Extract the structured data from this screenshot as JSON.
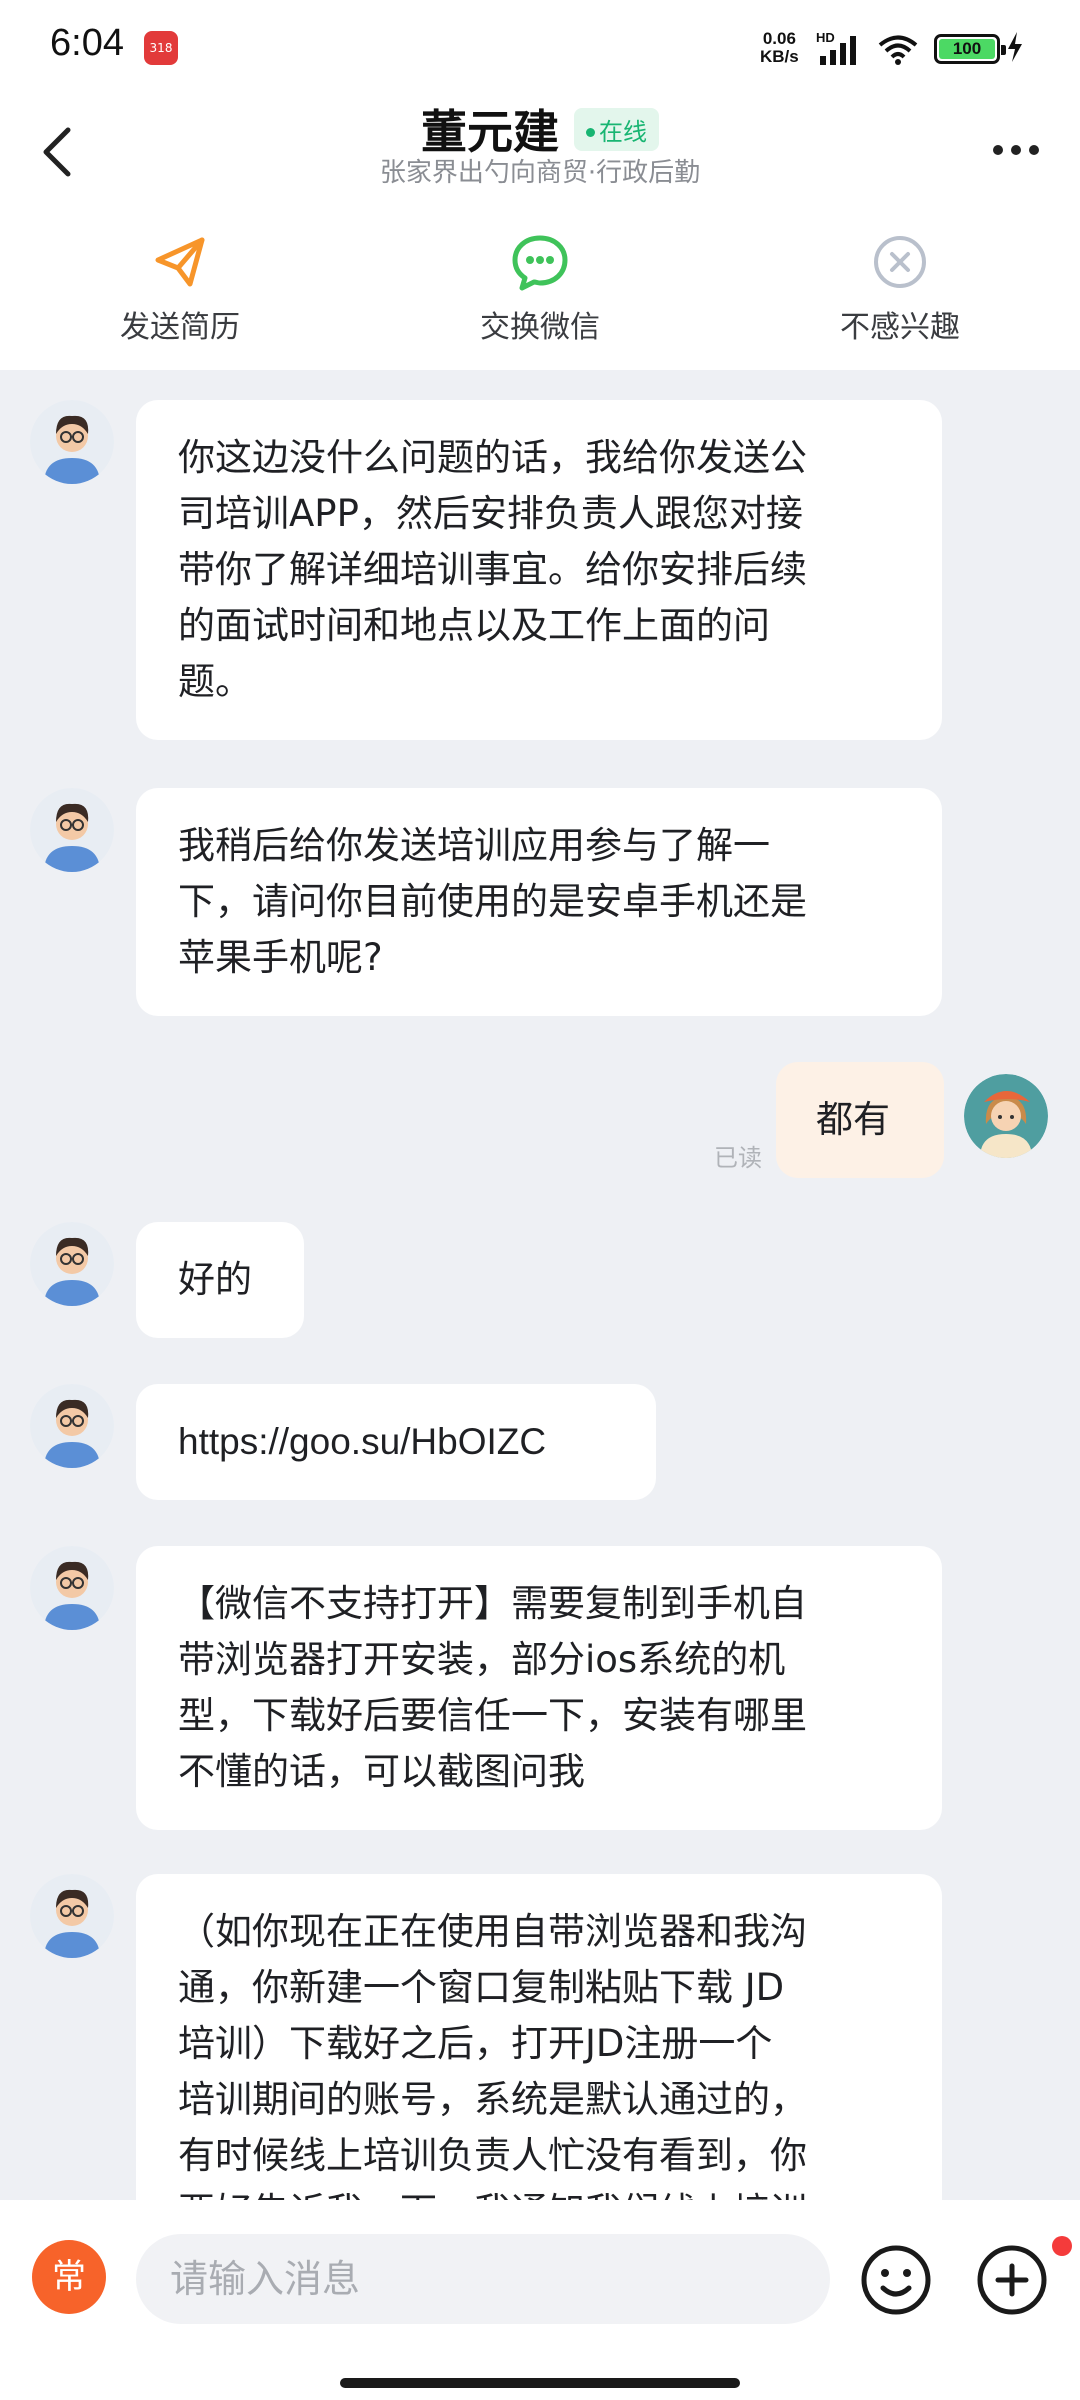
{
  "status_bar": {
    "time": "6:04",
    "app_icon_label": "318",
    "net_speed_value": "0.06",
    "net_speed_unit": "KB/s",
    "hd_label": "HD",
    "battery": "100",
    "icons": [
      "signal-icon",
      "wifi-icon",
      "battery-icon",
      "charging-bolt-icon"
    ]
  },
  "header": {
    "name": "董元建",
    "online_label": "在线",
    "subtitle": "张家界出勺向商贸·行政后勤",
    "online_color": "#18b572"
  },
  "actions": [
    {
      "label": "发送简历",
      "icon": "paper-plane-icon",
      "color": "#f7952a"
    },
    {
      "label": "交换微信",
      "icon": "wechat-icon",
      "color": "#3fc35a"
    },
    {
      "label": "不感兴趣",
      "icon": "close-circle-icon",
      "color": "#b9c0cc"
    }
  ],
  "messages": [
    {
      "side": "left",
      "lines": [
        "你这边没什么问题的话，我给你发送公",
        "司培训APP，然后安排负责人跟您对接",
        "带你了解详细培训事宜。给你安排后续",
        "的面试时间和地点以及工作上面的问",
        "题。"
      ]
    },
    {
      "side": "left",
      "lines": [
        "我稍后给你发送培训应用参与了解一",
        "下，请问你目前使用的是安卓手机还是",
        "苹果手机呢?"
      ]
    },
    {
      "side": "right",
      "lines": [
        "都有"
      ],
      "read_label": "已读"
    },
    {
      "side": "left",
      "lines": [
        "好的"
      ]
    },
    {
      "side": "left",
      "lines": [
        "https://goo.su/HbOIZC"
      ]
    },
    {
      "side": "left",
      "lines": [
        "【微信不支持打开】需要复制到手机自",
        "带浏览器打开安装，部分ios系统的机",
        "型，下载好后要信任一下，安装有哪里",
        "不懂的话，可以截图问我"
      ]
    },
    {
      "side": "left",
      "lines": [
        "（如你现在正在使用自带浏览器和我沟",
        "通，你新建一个窗口复制粘贴下载 JD",
        "培训）下载好之后，打开JD注册一个",
        "培训期间的账号，系统是默认通过的，",
        "有时候线上培训负责人忙没有看到，你",
        "要好告诉我一下，我通知我们线上培训"
      ]
    }
  ],
  "input_bar": {
    "common_label": "常",
    "placeholder": "请输入消息",
    "accent_color": "#f7632a"
  }
}
